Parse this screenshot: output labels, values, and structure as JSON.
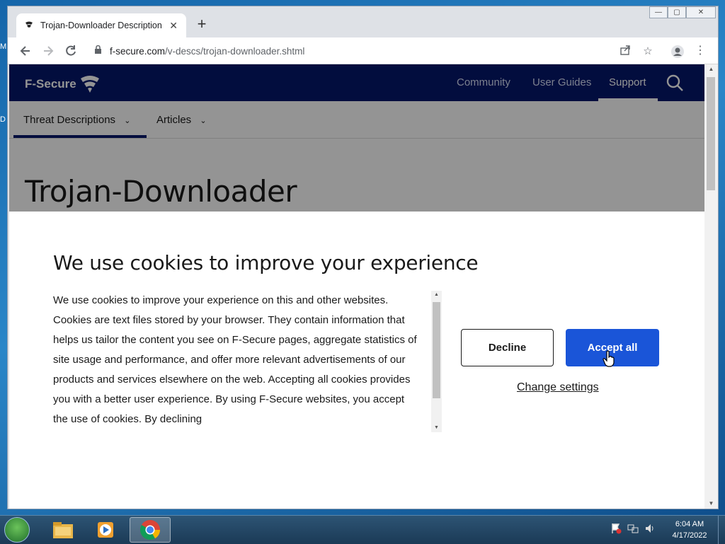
{
  "desktop": {
    "left_letters": [
      "M",
      "D"
    ]
  },
  "browser": {
    "tab_title": "Trojan-Downloader Description |",
    "tab_close": "✕",
    "new_tab": "+",
    "window_controls": {
      "minimize": "—",
      "maximize": "▢",
      "close": "✕"
    },
    "url_host": "f-secure.com",
    "url_path": "/v-descs/trojan-downloader.shtml"
  },
  "site": {
    "logo": "F-Secure",
    "nav": [
      "Community",
      "User Guides",
      "Support"
    ],
    "active_nav": "Support",
    "subnav": [
      "Threat Descriptions",
      "Articles"
    ],
    "page_title": "Trojan-Downloader"
  },
  "cookie": {
    "title": "We use cookies to improve your experience",
    "body": "We use cookies to improve your experience on this and other websites. Cookies are text files stored by your browser. They contain information that helps us tailor the content you see on F-Secure pages, aggregate statistics of site usage and performance, and offer more relevant advertisements of our products and services elsewhere on the web. Accepting all cookies provides you with a better user experience. By using F-Secure websites, you accept the use of cookies. By declining",
    "decline": "Decline",
    "accept": "Accept all",
    "change_settings": "Change settings"
  },
  "taskbar": {
    "time": "6:04 AM",
    "date": "4/17/2022"
  },
  "colors": {
    "brand_navy": "#04176c",
    "accept_blue": "#1a55d8"
  }
}
